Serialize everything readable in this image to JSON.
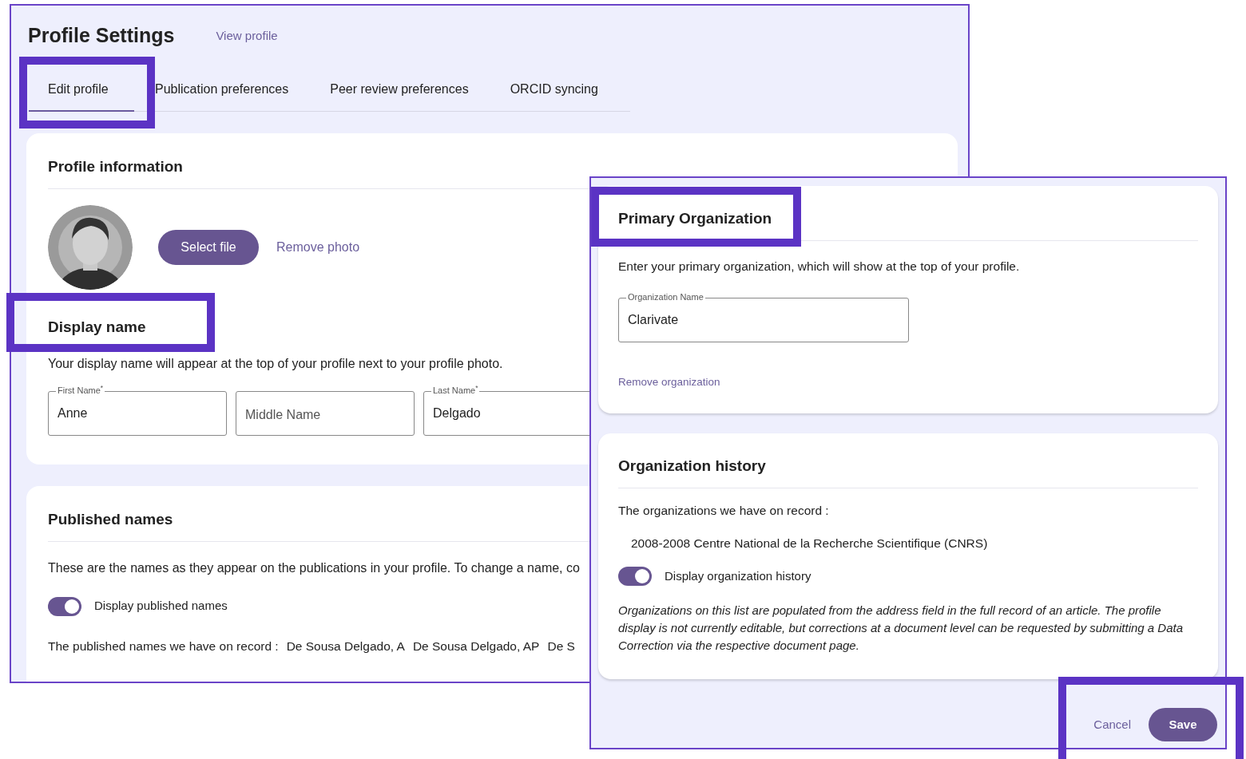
{
  "page": {
    "title": "Profile Settings",
    "view_profile_link": "View profile"
  },
  "tabs": [
    {
      "label": "Edit profile",
      "selected": true,
      "highlighted": true
    },
    {
      "label": "Publication preferences",
      "selected": false,
      "highlighted": false
    },
    {
      "label": "Peer review preferences",
      "selected": false,
      "highlighted": false
    },
    {
      "label": "ORCID syncing",
      "selected": false,
      "highlighted": false
    }
  ],
  "profile_information": {
    "title": "Profile information",
    "select_file_button": "Select file",
    "remove_photo_link": "Remove photo"
  },
  "display_name": {
    "title": "Display name",
    "highlighted": true,
    "description": "Your display name will appear at the top of your profile next to your profile photo.",
    "fields": [
      {
        "label": "First Name$^{*}$",
        "value": "Anne"
      },
      {
        "placeholder": "Middle Name"
      },
      {
        "label": "Last Name$^{*}$",
        "value": "Delgado"
      }
    ]
  },
  "published_names": {
    "title": "Published names",
    "description": "These are the names as they appear on the publications in your profile. To change a name, co",
    "toggle": {
      "label": "Display published names",
      "on": true
    },
    "record_label": "The published names we have on record :",
    "names": [
      "De Sousa Delgado, A",
      "De Sousa Delgado, AP",
      "De S"
    ]
  },
  "primary_organization": {
    "title": "Primary Organization",
    "highlighted": true,
    "description": "Enter your primary organization, which will show at the top of your profile.",
    "field": {
      "label": "Organization Name",
      "value": "Clarivate"
    },
    "remove_link": "Remove organization"
  },
  "organization_history": {
    "title": "Organization history",
    "record_label": "The organizations we have on record :",
    "items": [
      "2008-2008 Centre National de la Recherche Scientifique (CNRS)"
    ],
    "toggle": {
      "label": "Display organization history",
      "on": true
    },
    "note": "Organizations on this list are populated from the address field in the full record of an article. The profile display is not currently editable, but corrections at a document level can be requested by submitting a Data Correction via the respective document page."
  },
  "footer": {
    "highlighted": true,
    "cancel_button": "Cancel",
    "save_button": "Save"
  }
}
